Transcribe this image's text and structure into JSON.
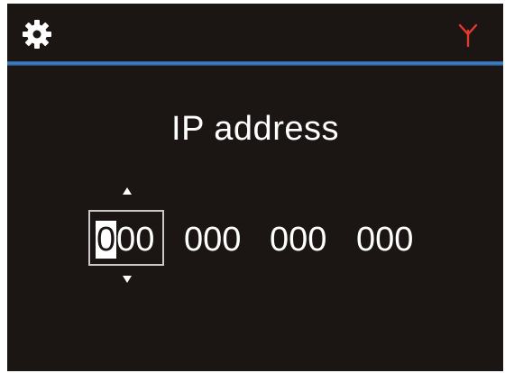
{
  "header": {
    "settings_icon": "gear-icon",
    "signal_icon": "antenna-icon",
    "accent_color": "#3f86cf",
    "signal_color": "#e23a2c"
  },
  "title": "IP address",
  "ip": {
    "octet1_cursor_digit": "0",
    "octet1_rest": "00",
    "octet2": "000",
    "octet3": "000",
    "octet4": "000"
  }
}
